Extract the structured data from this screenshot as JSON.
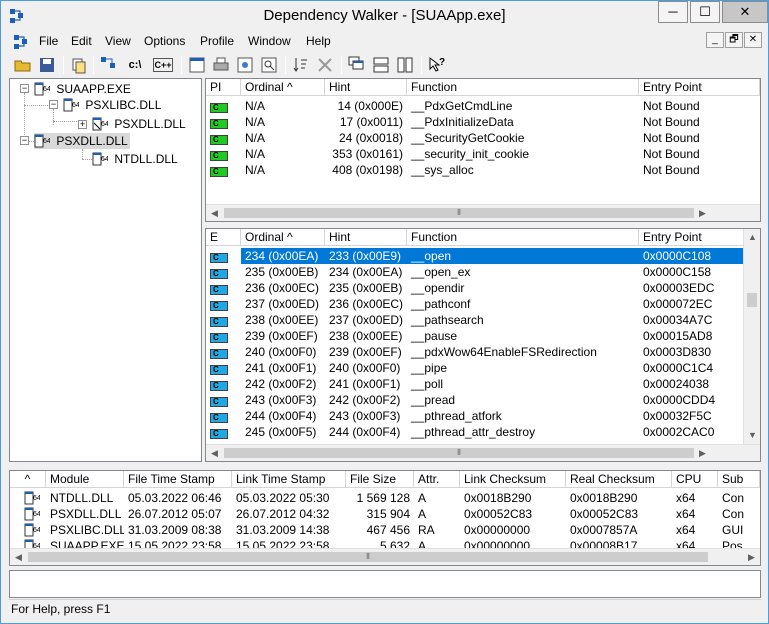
{
  "window": {
    "title": "Dependency Walker - [SUAApp.exe]",
    "minimize": "─",
    "maximize": "☐",
    "close": "✕"
  },
  "menu": [
    "File",
    "Edit",
    "View",
    "Options",
    "Profile",
    "Window",
    "Help"
  ],
  "mdi_buttons": [
    "_",
    "🗗",
    "✕"
  ],
  "toolbar": {
    "c_drive": "c:\\",
    "cpp": "C++"
  },
  "tree": [
    {
      "label": "SUAAPP.EXE",
      "expander": "−"
    },
    {
      "label": "PSXLIBC.DLL",
      "expander": "−"
    },
    {
      "label": "PSXDLL.DLL",
      "expander": "+"
    },
    {
      "label": "PSXDLL.DLL",
      "expander": "−"
    },
    {
      "label": "NTDLL.DLL",
      "expander": ""
    }
  ],
  "imports": {
    "columns": [
      "PI",
      "Ordinal ^",
      "Hint",
      "Function",
      "Entry Point"
    ],
    "rows": [
      {
        "pi": "C",
        "ordinal": "N/A",
        "hint": "14 (0x000E)",
        "function": "__PdxGetCmdLine",
        "entry": "Not Bound"
      },
      {
        "pi": "C",
        "ordinal": "N/A",
        "hint": "17 (0x0011)",
        "function": "__PdxInitializeData",
        "entry": "Not Bound"
      },
      {
        "pi": "C",
        "ordinal": "N/A",
        "hint": "24 (0x0018)",
        "function": "__SecurityGetCookie",
        "entry": "Not Bound"
      },
      {
        "pi": "C",
        "ordinal": "N/A",
        "hint": "353 (0x0161)",
        "function": "__security_init_cookie",
        "entry": "Not Bound"
      },
      {
        "pi": "C",
        "ordinal": "N/A",
        "hint": "408 (0x0198)",
        "function": "__sys_alloc",
        "entry": "Not Bound"
      }
    ]
  },
  "exports": {
    "columns": [
      "E",
      "Ordinal ^",
      "Hint",
      "Function",
      "Entry Point"
    ],
    "rows": [
      {
        "e": "C",
        "ordinal": "234 (0x00EA)",
        "hint": "233 (0x00E9)",
        "function": "__open",
        "entry": "0x0000C108"
      },
      {
        "e": "C",
        "ordinal": "235 (0x00EB)",
        "hint": "234 (0x00EA)",
        "function": "__open_ex",
        "entry": "0x0000C158"
      },
      {
        "e": "C",
        "ordinal": "236 (0x00EC)",
        "hint": "235 (0x00EB)",
        "function": "__opendir",
        "entry": "0x00003EDC"
      },
      {
        "e": "C",
        "ordinal": "237 (0x00ED)",
        "hint": "236 (0x00EC)",
        "function": "__pathconf",
        "entry": "0x000072EC"
      },
      {
        "e": "C",
        "ordinal": "238 (0x00EE)",
        "hint": "237 (0x00ED)",
        "function": "__pathsearch",
        "entry": "0x00034A7C"
      },
      {
        "e": "C",
        "ordinal": "239 (0x00EF)",
        "hint": "238 (0x00EE)",
        "function": "__pause",
        "entry": "0x00015AD8"
      },
      {
        "e": "C",
        "ordinal": "240 (0x00F0)",
        "hint": "239 (0x00EF)",
        "function": "__pdxWow64EnableFSRedirection",
        "entry": "0x0003D830"
      },
      {
        "e": "C",
        "ordinal": "241 (0x00F1)",
        "hint": "240 (0x00F0)",
        "function": "__pipe",
        "entry": "0x0000C1C4"
      },
      {
        "e": "C",
        "ordinal": "242 (0x00F2)",
        "hint": "241 (0x00F1)",
        "function": "__poll",
        "entry": "0x00024038"
      },
      {
        "e": "C",
        "ordinal": "243 (0x00F3)",
        "hint": "242 (0x00F2)",
        "function": "__pread",
        "entry": "0x0000CDD4"
      },
      {
        "e": "C",
        "ordinal": "244 (0x00F4)",
        "hint": "243 (0x00F3)",
        "function": "__pthread_atfork",
        "entry": "0x00032F5C"
      },
      {
        "e": "C",
        "ordinal": "245 (0x00F5)",
        "hint": "244 (0x00F4)",
        "function": "__pthread_attr_destroy",
        "entry": "0x0002CAC0"
      }
    ]
  },
  "modules": {
    "columns": [
      "^",
      "Module",
      "File Time Stamp",
      "Link Time Stamp",
      "File Size",
      "Attr.",
      "Link Checksum",
      "Real Checksum",
      "CPU",
      "Sub"
    ],
    "rows": [
      {
        "module": "NTDLL.DLL",
        "file_ts": "05.03.2022 06:46",
        "link_ts": "05.03.2022 05:30",
        "size": "1 569 128",
        "attr": "A",
        "link_ck": "0x0018B290",
        "real_ck": "0x0018B290",
        "cpu": "x64",
        "sub": "Con"
      },
      {
        "module": "PSXDLL.DLL",
        "file_ts": "26.07.2012 05:07",
        "link_ts": "26.07.2012 04:32",
        "size": "315 904",
        "attr": "A",
        "link_ck": "0x00052C83",
        "real_ck": "0x00052C83",
        "cpu": "x64",
        "sub": "Con"
      },
      {
        "module": "PSXLIBC.DLL",
        "file_ts": "31.03.2009 08:38",
        "link_ts": "31.03.2009 14:38",
        "size": "467 456",
        "attr": "RA",
        "link_ck": "0x00000000",
        "real_ck": "0x0007857A",
        "cpu": "x64",
        "sub": "GUI"
      },
      {
        "module": "SUAAPP.EXE",
        "file_ts": "15.05.2022 23:58",
        "link_ts": "15.05.2022 23:58",
        "size": "5 632",
        "attr": "A",
        "link_ck": "0x00000000",
        "real_ck": "0x00008B17",
        "cpu": "x64",
        "sub": "Pos"
      }
    ]
  },
  "status": "For Help, press F1",
  "colors": {
    "accent": "#0078d7",
    "green": "#22c822",
    "cyan": "#22a8e0"
  }
}
